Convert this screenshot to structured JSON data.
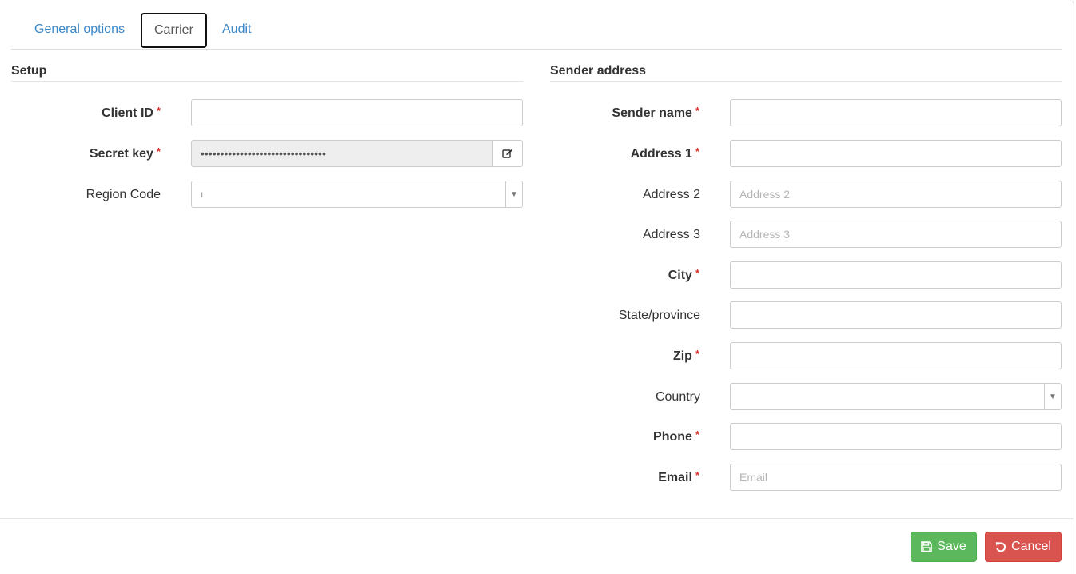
{
  "tabs": [
    {
      "label": "General options",
      "active": false
    },
    {
      "label": "Carrier",
      "active": true
    },
    {
      "label": "Audit",
      "active": false
    }
  ],
  "setup": {
    "title": "Setup",
    "client_id": {
      "label": "Client ID",
      "value": ""
    },
    "secret_key": {
      "label": "Secret key",
      "value": "••••••••••••••••••••••••••••••••"
    },
    "region_code": {
      "label": "Region Code",
      "value": "ı"
    }
  },
  "sender": {
    "title": "Sender address",
    "sender_name": {
      "label": "Sender name",
      "value": ""
    },
    "address1": {
      "label": "Address 1",
      "value": ""
    },
    "address2": {
      "label": "Address 2",
      "placeholder": "Address 2"
    },
    "address3": {
      "label": "Address 3",
      "placeholder": "Address 3"
    },
    "city": {
      "label": "City",
      "value": ""
    },
    "state": {
      "label": "State/province",
      "value": ""
    },
    "zip": {
      "label": "Zip",
      "value": ""
    },
    "country": {
      "label": "Country",
      "value": ""
    },
    "phone": {
      "label": "Phone",
      "value": ""
    },
    "email": {
      "label": "Email",
      "placeholder": "Email"
    }
  },
  "required_marker": "*",
  "buttons": {
    "save": "Save",
    "cancel": "Cancel"
  },
  "colors": {
    "link": "#3a87c8",
    "required": "#d9312b",
    "save": "#5cb85c",
    "cancel": "#d9534f"
  },
  "icons": {
    "edit": "edit-icon",
    "save": "floppy-disk-icon",
    "cancel": "undo-icon",
    "dropdown": "caret-down-icon"
  }
}
